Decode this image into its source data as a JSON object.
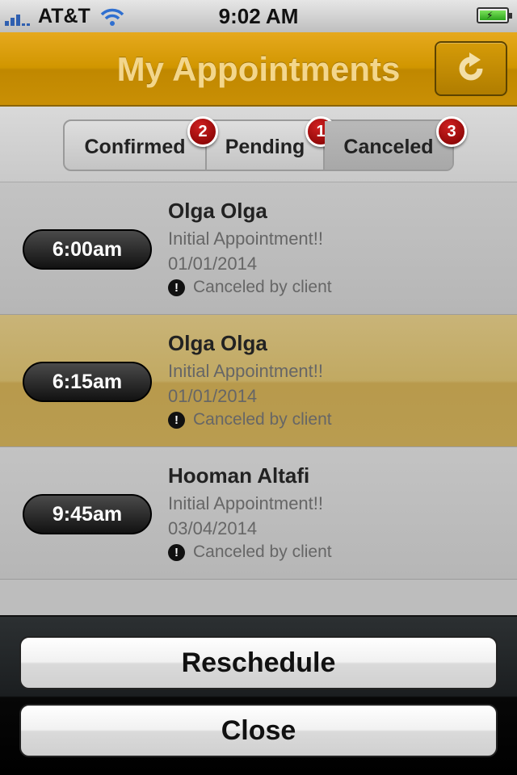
{
  "status_bar": {
    "carrier": "AT&T",
    "time": "9:02 AM"
  },
  "nav": {
    "title": "My Appointments",
    "refresh_icon": "refresh-icon"
  },
  "tabs": [
    {
      "label": "Confirmed",
      "badge": "2"
    },
    {
      "label": "Pending",
      "badge": "1"
    },
    {
      "label": "Canceled",
      "badge": "3",
      "selected": true
    }
  ],
  "appointments": [
    {
      "time": "6:00am",
      "name": "Olga Olga",
      "type": "Initial Appointment!!",
      "date": "01/01/2014",
      "status": "Canceled by client",
      "selected": false
    },
    {
      "time": "6:15am",
      "name": "Olga Olga",
      "type": "Initial Appointment!!",
      "date": "01/01/2014",
      "status": "Canceled by client",
      "selected": true
    },
    {
      "time": "9:45am",
      "name": "Hooman Altafi",
      "type": "Initial Appointment!!",
      "date": "03/04/2014",
      "status": "Canceled by client",
      "selected": false
    }
  ],
  "actions": {
    "reschedule": "Reschedule",
    "close": "Close"
  },
  "colors": {
    "nav_gold": "#d19600",
    "selected_row": "#c1a962",
    "badge_red": "#a00000"
  }
}
